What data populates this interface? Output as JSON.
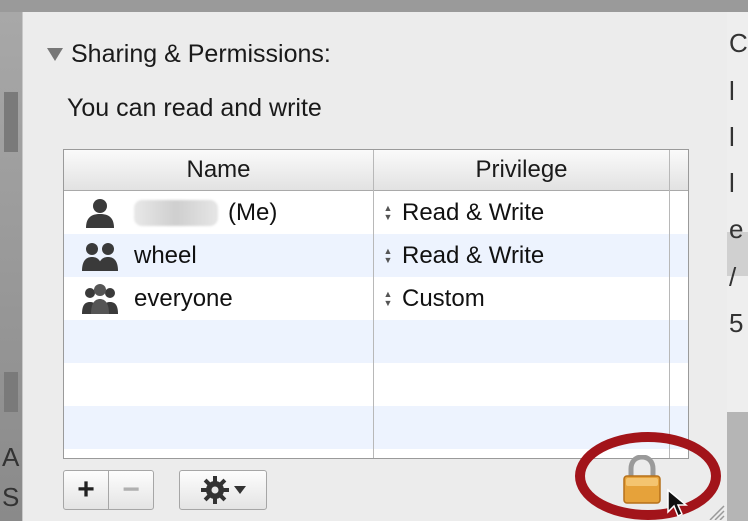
{
  "panel": {
    "section_title": "Sharing & Permissions:",
    "status_text": "You can read and write"
  },
  "table": {
    "columns": {
      "name": "Name",
      "privilege": "Privilege"
    },
    "rows": [
      {
        "suffix": "(Me)",
        "privilege": "Read & Write",
        "icon": "single-user-icon"
      },
      {
        "name": "wheel",
        "privilege": "Read & Write",
        "icon": "group-icon"
      },
      {
        "name": "everyone",
        "privilege": "Custom",
        "icon": "everyone-icon"
      }
    ]
  },
  "toolbar": {
    "add_label": "+",
    "remove_label": "−",
    "action_icon": "gear-icon"
  },
  "background_right_chars": [
    "C",
    "l",
    "l",
    "l",
    "e",
    "/",
    "5"
  ],
  "background_left_chars": [
    "A",
    "S"
  ],
  "colors": {
    "panel_bg": "#ececec",
    "table_alt_row": "#edf3fe",
    "highlight_ring": "#a2141a",
    "lock": "#e6a23a"
  }
}
